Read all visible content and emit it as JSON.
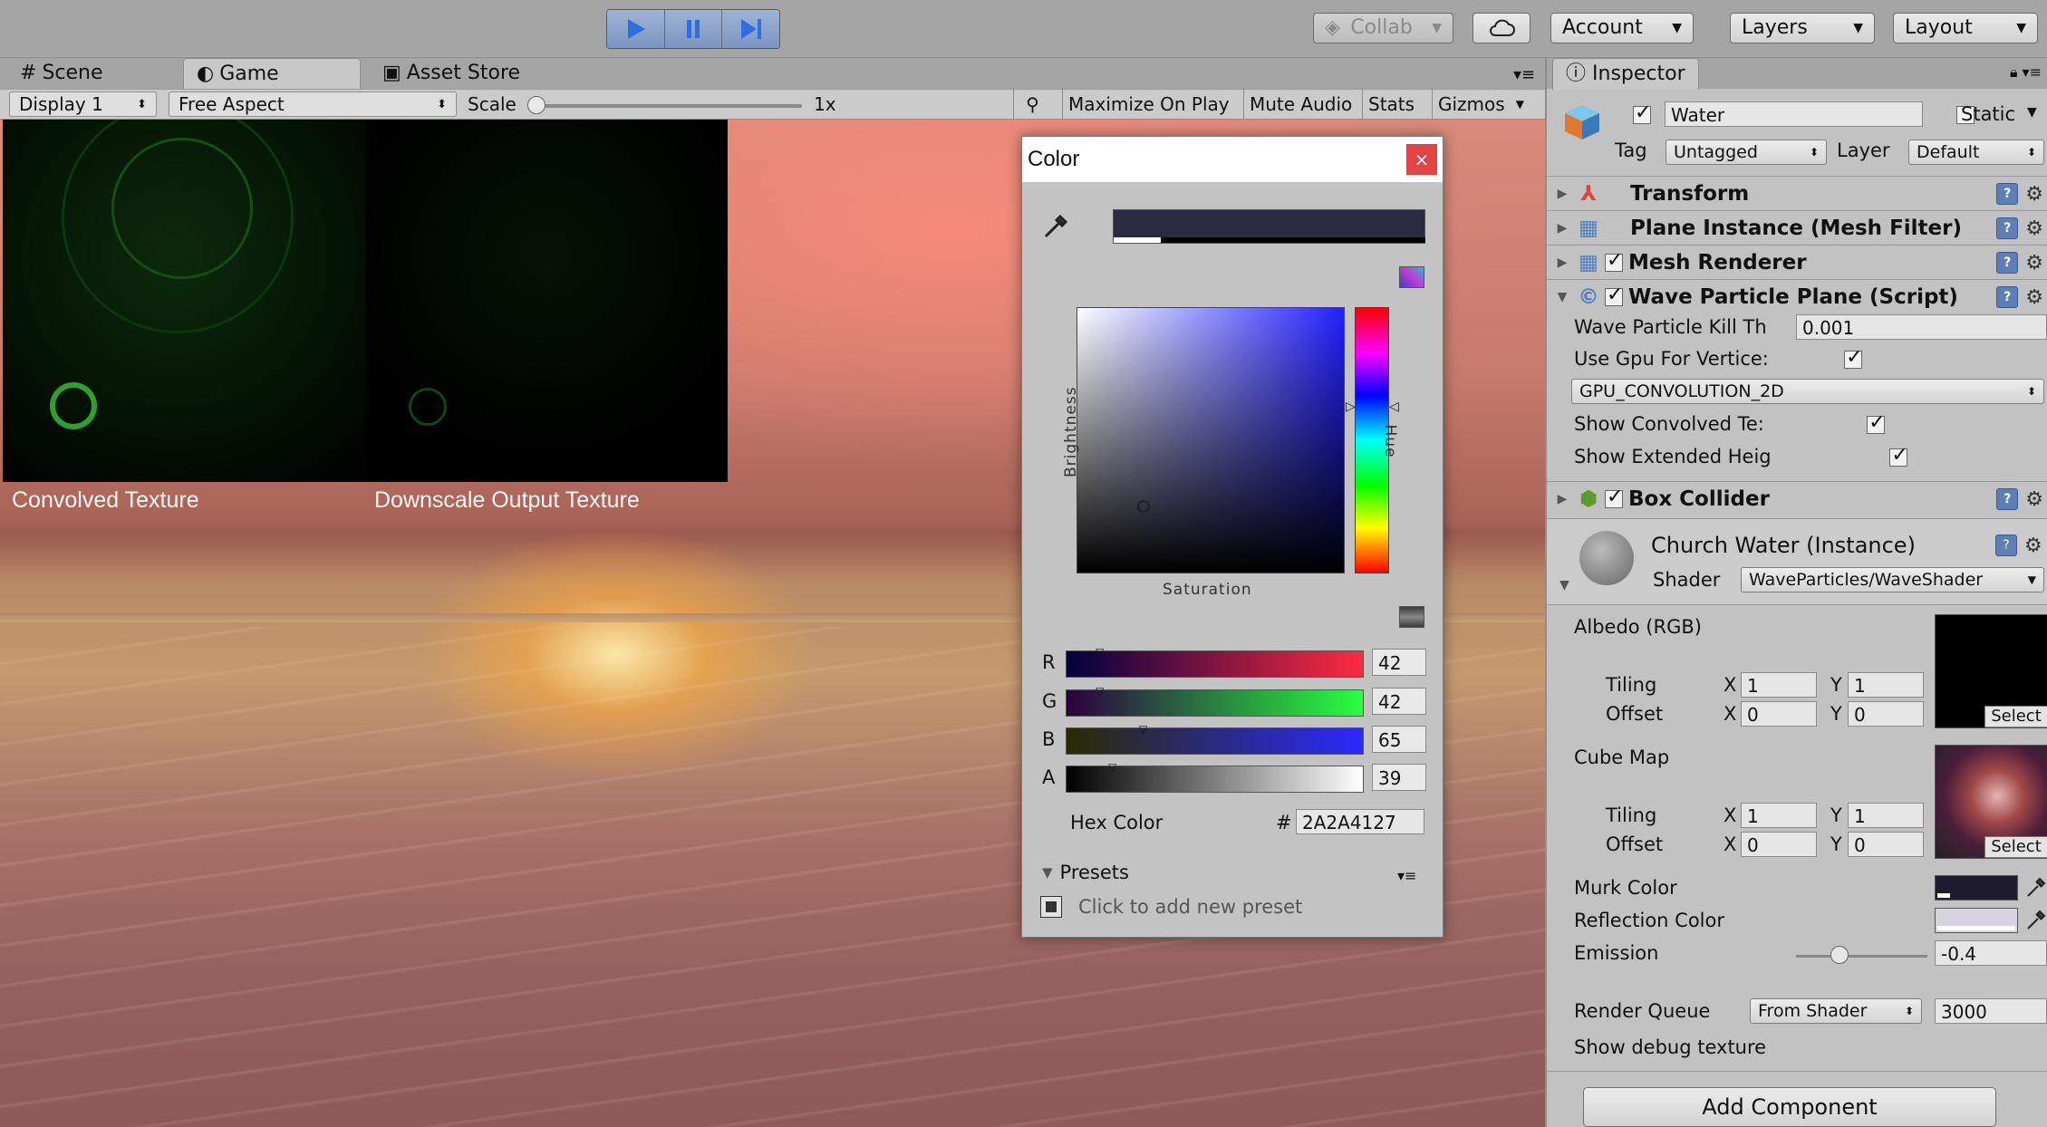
{
  "toolbar": {
    "collab_label": "Collab",
    "account_label": "Account",
    "layers_label": "Layers",
    "layout_label": "Layout"
  },
  "view_tabs": {
    "scene": "Scene",
    "game": "Game",
    "asset_store": "Asset Store"
  },
  "gamebar": {
    "display": "Display 1",
    "aspect": "Free Aspect",
    "scale_label": "Scale",
    "scale_value": "1x",
    "maximize": "Maximize On Play",
    "mute": "Mute Audio",
    "stats": "Stats",
    "gizmos": "Gizmos"
  },
  "game": {
    "convolved_label": "Convolved Texture",
    "downscale_label": "Downscale Output Texture"
  },
  "color_picker": {
    "title": "Color",
    "close": "×",
    "brightness_label": "Brightness",
    "hue_label": "Hue",
    "saturation_label": "Saturation",
    "r": {
      "label": "R",
      "value": "42"
    },
    "g": {
      "label": "G",
      "value": "42"
    },
    "b": {
      "label": "B",
      "value": "65"
    },
    "a": {
      "label": "A",
      "value": "39"
    },
    "hex_label": "Hex Color",
    "hex_hash": "#",
    "hex_value": "2A2A4127",
    "presets_label": "Presets",
    "add_preset": "Click to add new preset",
    "current_color": "#2a2a41"
  },
  "inspector": {
    "tab": "Inspector",
    "object_name": "Water",
    "static_label": "Static",
    "tag_label": "Tag",
    "tag_value": "Untagged",
    "layer_label": "Layer",
    "layer_value": "Default",
    "components": {
      "transform": "Transform",
      "mesh_filter": "Plane Instance (Mesh Filter)",
      "mesh_renderer": "Mesh Renderer",
      "wave_script": "Wave Particle Plane (Script)",
      "box_collider": "Box Collider"
    },
    "script": {
      "kill_label": "Wave Particle Kill Th",
      "kill_value": "0.001",
      "gpu_label": "Use Gpu For Vertice:",
      "mode_value": "GPU_CONVOLUTION_2D",
      "show_conv_label": "Show Convolved Te:",
      "show_ext_label": "Show Extended Heig"
    },
    "material": {
      "name": "Church Water (Instance)",
      "shader_label": "Shader",
      "shader_value": "WaveParticles/WaveShader",
      "albedo_label": "Albedo (RGB)",
      "tiling_label": "Tiling",
      "offset_label": "Offset",
      "x": "X",
      "y": "Y",
      "albedo_tiling_x": "1",
      "albedo_tiling_y": "1",
      "albedo_offset_x": "0",
      "albedo_offset_y": "0",
      "cube_label": "Cube Map",
      "cube_tiling_x": "1",
      "cube_tiling_y": "1",
      "cube_offset_x": "0",
      "cube_offset_y": "0",
      "select": "Select",
      "murk_label": "Murk Color",
      "reflection_label": "Reflection Color",
      "emission_label": "Emission",
      "emission_value": "-0.4",
      "render_queue_label": "Render Queue",
      "render_queue_mode": "From Shader",
      "render_queue_value": "3000",
      "debug_label": "Show debug texture"
    },
    "add_component": "Add Component"
  }
}
